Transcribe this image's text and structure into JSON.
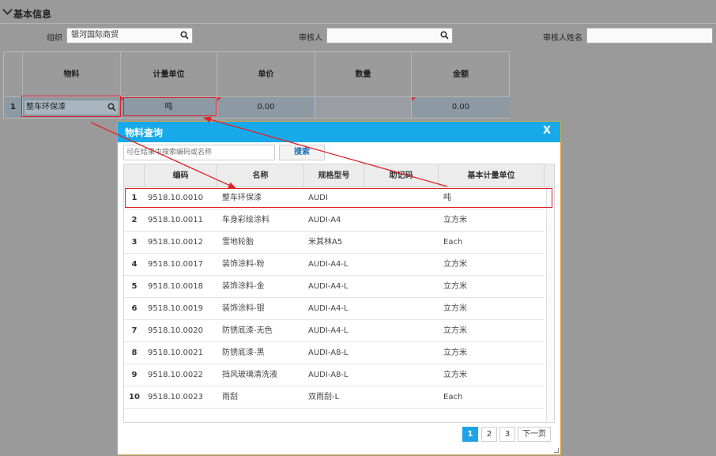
{
  "section": {
    "title": "基本信息"
  },
  "form": {
    "org_label": "组织",
    "org_value": "银河国际商贸",
    "reviewer_label": "审核人",
    "reviewer_value": "",
    "reviewer_name_label": "审核人姓名",
    "reviewer_name_value": ""
  },
  "grid": {
    "headers": [
      "物料",
      "计量单位",
      "单价",
      "数量",
      "金额"
    ],
    "row": {
      "index": "1",
      "material": "整车环保漆",
      "unit": "吨",
      "price": "0.00",
      "quantity": "",
      "amount": "0.00"
    }
  },
  "dialog": {
    "title": "物料查询",
    "close": "X",
    "search_placeholder": "可在结果中搜索编码或名称",
    "search_button": "搜索",
    "columns": [
      "编码",
      "名称",
      "规格型号",
      "助记码",
      "基本计量单位"
    ],
    "rows": [
      {
        "n": "1",
        "code": "9518.10.0010",
        "name": "整车环保漆",
        "spec": "AUDI",
        "mnemonic": "",
        "unit": "吨"
      },
      {
        "n": "2",
        "code": "9518.10.0011",
        "name": "车身彩绘涂料",
        "spec": "AUDI-A4",
        "mnemonic": "",
        "unit": "立方米"
      },
      {
        "n": "3",
        "code": "9518.10.0012",
        "name": "雪地轮胎",
        "spec": "米其林A5",
        "mnemonic": "",
        "unit": "Each"
      },
      {
        "n": "4",
        "code": "9518.10.0017",
        "name": "装饰涂料-粉",
        "spec": "AUDI-A4-L",
        "mnemonic": "",
        "unit": "立方米"
      },
      {
        "n": "5",
        "code": "9518.10.0018",
        "name": "装饰涂料-金",
        "spec": "AUDI-A4-L",
        "mnemonic": "",
        "unit": "立方米"
      },
      {
        "n": "6",
        "code": "9518.10.0019",
        "name": "装饰涂料-银",
        "spec": "AUDI-A4-L",
        "mnemonic": "",
        "unit": "立方米"
      },
      {
        "n": "7",
        "code": "9518.10.0020",
        "name": "防锈底漆-无色",
        "spec": "AUDI-A4-L",
        "mnemonic": "",
        "unit": "立方米"
      },
      {
        "n": "8",
        "code": "9518.10.0021",
        "name": "防锈底漆-黑",
        "spec": "AUDI-A8-L",
        "mnemonic": "",
        "unit": "立方米"
      },
      {
        "n": "9",
        "code": "9518.10.0022",
        "name": "挡风玻璃清洗液",
        "spec": "AUDI-A8-L",
        "mnemonic": "",
        "unit": "立方米"
      },
      {
        "n": "10",
        "code": "9518.10.0023",
        "name": "雨刮",
        "spec": "双雨刮-L",
        "mnemonic": "",
        "unit": "Each"
      }
    ],
    "pager": {
      "pages": [
        "1",
        "2",
        "3"
      ],
      "next": "下一页",
      "current": "1"
    }
  },
  "colors": {
    "dialog_title": "#17a9e9",
    "highlight": "#e0212a",
    "active_page": "#1da4e6"
  }
}
